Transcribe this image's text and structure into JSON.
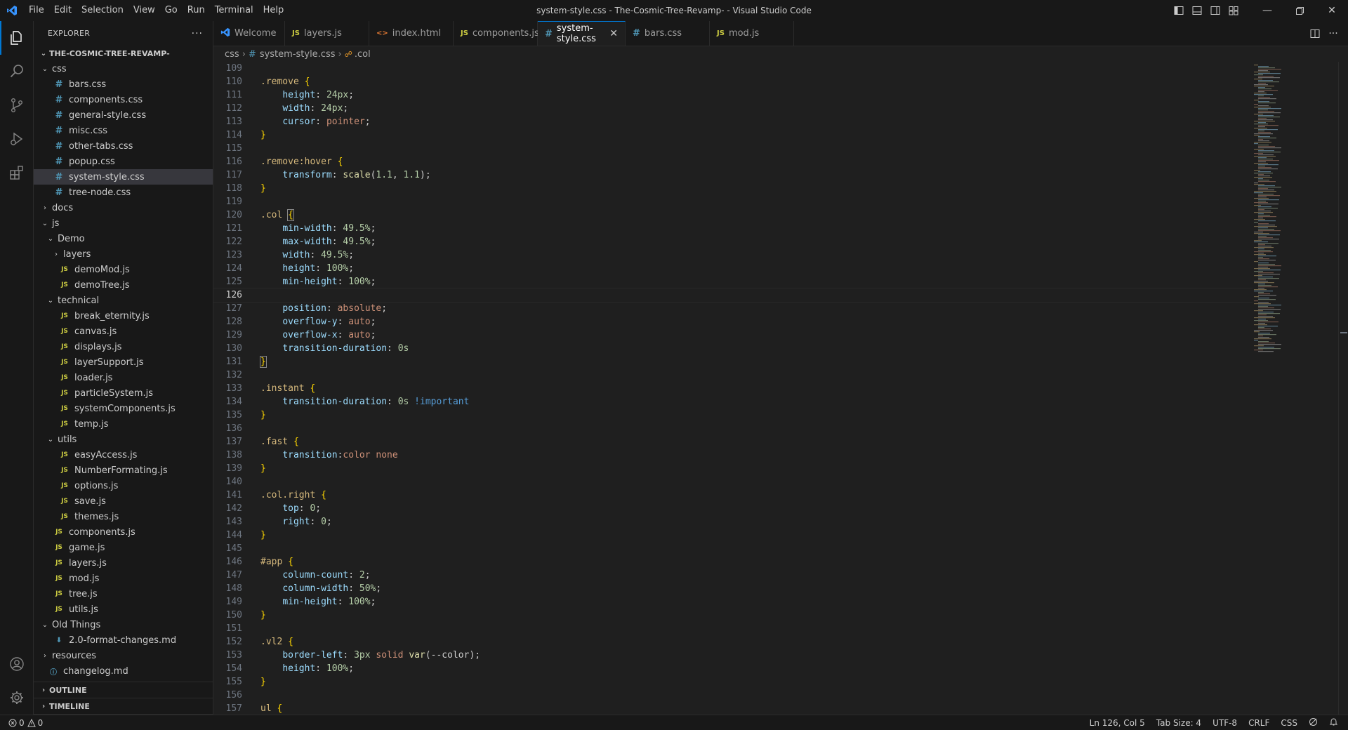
{
  "window": {
    "title": "system-style.css - The-Cosmic-Tree-Revamp- - Visual Studio Code"
  },
  "menu": [
    "File",
    "Edit",
    "Selection",
    "View",
    "Go",
    "Run",
    "Terminal",
    "Help"
  ],
  "explorer": {
    "header": "EXPLORER",
    "root": "THE-COSMIC-TREE-REVAMP-",
    "tree": [
      {
        "depth": 1,
        "type": "folder",
        "open": true,
        "label": "css"
      },
      {
        "depth": 2,
        "type": "css",
        "label": "bars.css"
      },
      {
        "depth": 2,
        "type": "css",
        "label": "components.css"
      },
      {
        "depth": 2,
        "type": "css",
        "label": "general-style.css"
      },
      {
        "depth": 2,
        "type": "css",
        "label": "misc.css"
      },
      {
        "depth": 2,
        "type": "css",
        "label": "other-tabs.css"
      },
      {
        "depth": 2,
        "type": "css",
        "label": "popup.css"
      },
      {
        "depth": 2,
        "type": "css",
        "label": "system-style.css",
        "selected": true
      },
      {
        "depth": 2,
        "type": "css",
        "label": "tree-node.css"
      },
      {
        "depth": 1,
        "type": "folder",
        "open": false,
        "label": "docs"
      },
      {
        "depth": 1,
        "type": "folder",
        "open": true,
        "label": "js"
      },
      {
        "depth": 2,
        "type": "folder",
        "open": true,
        "label": "Demo"
      },
      {
        "depth": 3,
        "type": "folder",
        "open": false,
        "label": "layers"
      },
      {
        "depth": 3,
        "type": "js",
        "label": "demoMod.js"
      },
      {
        "depth": 3,
        "type": "js",
        "label": "demoTree.js"
      },
      {
        "depth": 2,
        "type": "folder",
        "open": true,
        "label": "technical"
      },
      {
        "depth": 3,
        "type": "js",
        "label": "break_eternity.js"
      },
      {
        "depth": 3,
        "type": "js",
        "label": "canvas.js"
      },
      {
        "depth": 3,
        "type": "js",
        "label": "displays.js"
      },
      {
        "depth": 3,
        "type": "js",
        "label": "layerSupport.js"
      },
      {
        "depth": 3,
        "type": "js",
        "label": "loader.js"
      },
      {
        "depth": 3,
        "type": "js",
        "label": "particleSystem.js"
      },
      {
        "depth": 3,
        "type": "js",
        "label": "systemComponents.js"
      },
      {
        "depth": 3,
        "type": "js",
        "label": "temp.js"
      },
      {
        "depth": 2,
        "type": "folder",
        "open": true,
        "label": "utils"
      },
      {
        "depth": 3,
        "type": "js",
        "label": "easyAccess.js"
      },
      {
        "depth": 3,
        "type": "js",
        "label": "NumberFormating.js"
      },
      {
        "depth": 3,
        "type": "js",
        "label": "options.js"
      },
      {
        "depth": 3,
        "type": "js",
        "label": "save.js"
      },
      {
        "depth": 3,
        "type": "js",
        "label": "themes.js"
      },
      {
        "depth": 2,
        "type": "js",
        "label": "components.js"
      },
      {
        "depth": 2,
        "type": "js",
        "label": "game.js"
      },
      {
        "depth": 2,
        "type": "js",
        "label": "layers.js"
      },
      {
        "depth": 2,
        "type": "js",
        "label": "mod.js"
      },
      {
        "depth": 2,
        "type": "js",
        "label": "tree.js"
      },
      {
        "depth": 2,
        "type": "js",
        "label": "utils.js"
      },
      {
        "depth": 1,
        "type": "folder",
        "open": true,
        "label": "Old Things"
      },
      {
        "depth": 2,
        "type": "md",
        "label": "2.0-format-changes.md"
      },
      {
        "depth": 1,
        "type": "folder",
        "open": false,
        "label": "resources"
      },
      {
        "depth": 1,
        "type": "info",
        "label": "changelog.md"
      }
    ],
    "outline": "OUTLINE",
    "timeline": "TIMELINE"
  },
  "tabs": [
    {
      "label": "Welcome",
      "icon": "vscode",
      "color": "#3794ff"
    },
    {
      "label": "layers.js",
      "icon": "JS",
      "color": "#cbcb41"
    },
    {
      "label": "index.html",
      "icon": "<>",
      "color": "#e37933"
    },
    {
      "label": "components.js",
      "icon": "JS",
      "color": "#cbcb41"
    },
    {
      "label": "system-style.css",
      "icon": "#",
      "color": "#519aba",
      "active": true
    },
    {
      "label": "bars.css",
      "icon": "#",
      "color": "#519aba"
    },
    {
      "label": "mod.js",
      "icon": "JS",
      "color": "#cbcb41"
    }
  ],
  "breadcrumb": {
    "folder": "css",
    "file": "system-style.css",
    "symbol": ".col"
  },
  "code": {
    "current_line": 126,
    "lines": [
      {
        "n": 109,
        "t": []
      },
      {
        "n": 110,
        "t": [
          [
            "sel",
            ".remove"
          ],
          [
            "punc",
            " "
          ],
          [
            "brace",
            "{"
          ]
        ]
      },
      {
        "n": 111,
        "t": [
          [
            "punc",
            "    "
          ],
          [
            "prop",
            "height"
          ],
          [
            "punc",
            ": "
          ],
          [
            "num",
            "24px"
          ],
          [
            "punc",
            ";"
          ]
        ]
      },
      {
        "n": 112,
        "t": [
          [
            "punc",
            "    "
          ],
          [
            "prop",
            "width"
          ],
          [
            "punc",
            ": "
          ],
          [
            "num",
            "24px"
          ],
          [
            "punc",
            ";"
          ]
        ]
      },
      {
        "n": 113,
        "t": [
          [
            "punc",
            "    "
          ],
          [
            "prop",
            "cursor"
          ],
          [
            "punc",
            ": "
          ],
          [
            "val",
            "pointer"
          ],
          [
            "punc",
            ";"
          ]
        ]
      },
      {
        "n": 114,
        "t": [
          [
            "brace",
            "}"
          ]
        ]
      },
      {
        "n": 115,
        "t": []
      },
      {
        "n": 116,
        "t": [
          [
            "sel",
            ".remove:hover"
          ],
          [
            "punc",
            " "
          ],
          [
            "brace",
            "{"
          ]
        ]
      },
      {
        "n": 117,
        "t": [
          [
            "punc",
            "    "
          ],
          [
            "prop",
            "transform"
          ],
          [
            "punc",
            ": "
          ],
          [
            "func",
            "scale"
          ],
          [
            "punc",
            "("
          ],
          [
            "num",
            "1.1"
          ],
          [
            "punc",
            ", "
          ],
          [
            "num",
            "1.1"
          ],
          [
            "punc",
            ");"
          ]
        ]
      },
      {
        "n": 118,
        "t": [
          [
            "brace",
            "}"
          ]
        ]
      },
      {
        "n": 119,
        "t": []
      },
      {
        "n": 120,
        "t": [
          [
            "sel",
            ".col"
          ],
          [
            "punc",
            " "
          ],
          [
            "brace",
            "{"
          ]
        ]
      },
      {
        "n": 121,
        "t": [
          [
            "punc",
            "    "
          ],
          [
            "prop",
            "min-width"
          ],
          [
            "punc",
            ": "
          ],
          [
            "num",
            "49.5%"
          ],
          [
            "punc",
            ";"
          ]
        ]
      },
      {
        "n": 122,
        "t": [
          [
            "punc",
            "    "
          ],
          [
            "prop",
            "max-width"
          ],
          [
            "punc",
            ": "
          ],
          [
            "num",
            "49.5%"
          ],
          [
            "punc",
            ";"
          ]
        ]
      },
      {
        "n": 123,
        "t": [
          [
            "punc",
            "    "
          ],
          [
            "prop",
            "width"
          ],
          [
            "punc",
            ": "
          ],
          [
            "num",
            "49.5%"
          ],
          [
            "punc",
            ";"
          ]
        ]
      },
      {
        "n": 124,
        "t": [
          [
            "punc",
            "    "
          ],
          [
            "prop",
            "height"
          ],
          [
            "punc",
            ": "
          ],
          [
            "num",
            "100%"
          ],
          [
            "punc",
            ";"
          ]
        ]
      },
      {
        "n": 125,
        "t": [
          [
            "punc",
            "    "
          ],
          [
            "prop",
            "min-height"
          ],
          [
            "punc",
            ": "
          ],
          [
            "num",
            "100%"
          ],
          [
            "punc",
            ";"
          ]
        ]
      },
      {
        "n": 126,
        "t": []
      },
      {
        "n": 127,
        "t": [
          [
            "punc",
            "    "
          ],
          [
            "prop",
            "position"
          ],
          [
            "punc",
            ": "
          ],
          [
            "val",
            "absolute"
          ],
          [
            "punc",
            ";"
          ]
        ]
      },
      {
        "n": 128,
        "t": [
          [
            "punc",
            "    "
          ],
          [
            "prop",
            "overflow-y"
          ],
          [
            "punc",
            ": "
          ],
          [
            "val",
            "auto"
          ],
          [
            "punc",
            ";"
          ]
        ]
      },
      {
        "n": 129,
        "t": [
          [
            "punc",
            "    "
          ],
          [
            "prop",
            "overflow-x"
          ],
          [
            "punc",
            ": "
          ],
          [
            "val",
            "auto"
          ],
          [
            "punc",
            ";"
          ]
        ]
      },
      {
        "n": 130,
        "t": [
          [
            "punc",
            "    "
          ],
          [
            "prop",
            "transition-duration"
          ],
          [
            "punc",
            ": "
          ],
          [
            "num",
            "0s"
          ]
        ]
      },
      {
        "n": 131,
        "t": [
          [
            "brace",
            "}"
          ]
        ]
      },
      {
        "n": 132,
        "t": []
      },
      {
        "n": 133,
        "t": [
          [
            "sel",
            ".instant"
          ],
          [
            "punc",
            " "
          ],
          [
            "brace",
            "{"
          ]
        ]
      },
      {
        "n": 134,
        "t": [
          [
            "punc",
            "    "
          ],
          [
            "prop",
            "transition-duration"
          ],
          [
            "punc",
            ": "
          ],
          [
            "num",
            "0s"
          ],
          [
            "punc",
            " "
          ],
          [
            "imp",
            "!important"
          ]
        ]
      },
      {
        "n": 135,
        "t": [
          [
            "brace",
            "}"
          ]
        ]
      },
      {
        "n": 136,
        "t": []
      },
      {
        "n": 137,
        "t": [
          [
            "sel",
            ".fast"
          ],
          [
            "punc",
            " "
          ],
          [
            "brace",
            "{"
          ]
        ]
      },
      {
        "n": 138,
        "t": [
          [
            "punc",
            "    "
          ],
          [
            "prop",
            "transition"
          ],
          [
            "punc",
            ":"
          ],
          [
            "val",
            "color none"
          ]
        ]
      },
      {
        "n": 139,
        "t": [
          [
            "brace",
            "}"
          ]
        ]
      },
      {
        "n": 140,
        "t": []
      },
      {
        "n": 141,
        "t": [
          [
            "sel",
            ".col.right"
          ],
          [
            "punc",
            " "
          ],
          [
            "brace",
            "{"
          ]
        ]
      },
      {
        "n": 142,
        "t": [
          [
            "punc",
            "    "
          ],
          [
            "prop",
            "top"
          ],
          [
            "punc",
            ": "
          ],
          [
            "num",
            "0"
          ],
          [
            "punc",
            ";"
          ]
        ]
      },
      {
        "n": 143,
        "t": [
          [
            "punc",
            "    "
          ],
          [
            "prop",
            "right"
          ],
          [
            "punc",
            ": "
          ],
          [
            "num",
            "0"
          ],
          [
            "punc",
            ";"
          ]
        ]
      },
      {
        "n": 144,
        "t": [
          [
            "brace",
            "}"
          ]
        ]
      },
      {
        "n": 145,
        "t": []
      },
      {
        "n": 146,
        "t": [
          [
            "sel",
            "#app"
          ],
          [
            "punc",
            " "
          ],
          [
            "brace",
            "{"
          ]
        ]
      },
      {
        "n": 147,
        "t": [
          [
            "punc",
            "    "
          ],
          [
            "prop",
            "column-count"
          ],
          [
            "punc",
            ": "
          ],
          [
            "num",
            "2"
          ],
          [
            "punc",
            ";"
          ]
        ]
      },
      {
        "n": 148,
        "t": [
          [
            "punc",
            "    "
          ],
          [
            "prop",
            "column-width"
          ],
          [
            "punc",
            ": "
          ],
          [
            "num",
            "50%"
          ],
          [
            "punc",
            ";"
          ]
        ]
      },
      {
        "n": 149,
        "t": [
          [
            "punc",
            "    "
          ],
          [
            "prop",
            "min-height"
          ],
          [
            "punc",
            ": "
          ],
          [
            "num",
            "100%"
          ],
          [
            "punc",
            ";"
          ]
        ]
      },
      {
        "n": 150,
        "t": [
          [
            "brace",
            "}"
          ]
        ]
      },
      {
        "n": 151,
        "t": []
      },
      {
        "n": 152,
        "t": [
          [
            "sel",
            ".vl2"
          ],
          [
            "punc",
            " "
          ],
          [
            "brace",
            "{"
          ]
        ]
      },
      {
        "n": 153,
        "t": [
          [
            "punc",
            "    "
          ],
          [
            "prop",
            "border-left"
          ],
          [
            "punc",
            ": "
          ],
          [
            "num",
            "3px"
          ],
          [
            "punc",
            " "
          ],
          [
            "val",
            "solid"
          ],
          [
            "punc",
            " "
          ],
          [
            "func",
            "var"
          ],
          [
            "punc",
            "(--color);"
          ]
        ]
      },
      {
        "n": 154,
        "t": [
          [
            "punc",
            "    "
          ],
          [
            "prop",
            "height"
          ],
          [
            "punc",
            ": "
          ],
          [
            "num",
            "100%"
          ],
          [
            "punc",
            ";"
          ]
        ]
      },
      {
        "n": 155,
        "t": [
          [
            "brace",
            "}"
          ]
        ]
      },
      {
        "n": 156,
        "t": []
      },
      {
        "n": 157,
        "t": [
          [
            "sel",
            "ul"
          ],
          [
            "punc",
            " "
          ],
          [
            "brace",
            "{"
          ]
        ]
      }
    ]
  },
  "status": {
    "errors": "0",
    "warnings": "0",
    "position": "Ln 126, Col 5",
    "tab_size": "Tab Size: 4",
    "encoding": "UTF-8",
    "eol": "CRLF",
    "language": "CSS"
  }
}
